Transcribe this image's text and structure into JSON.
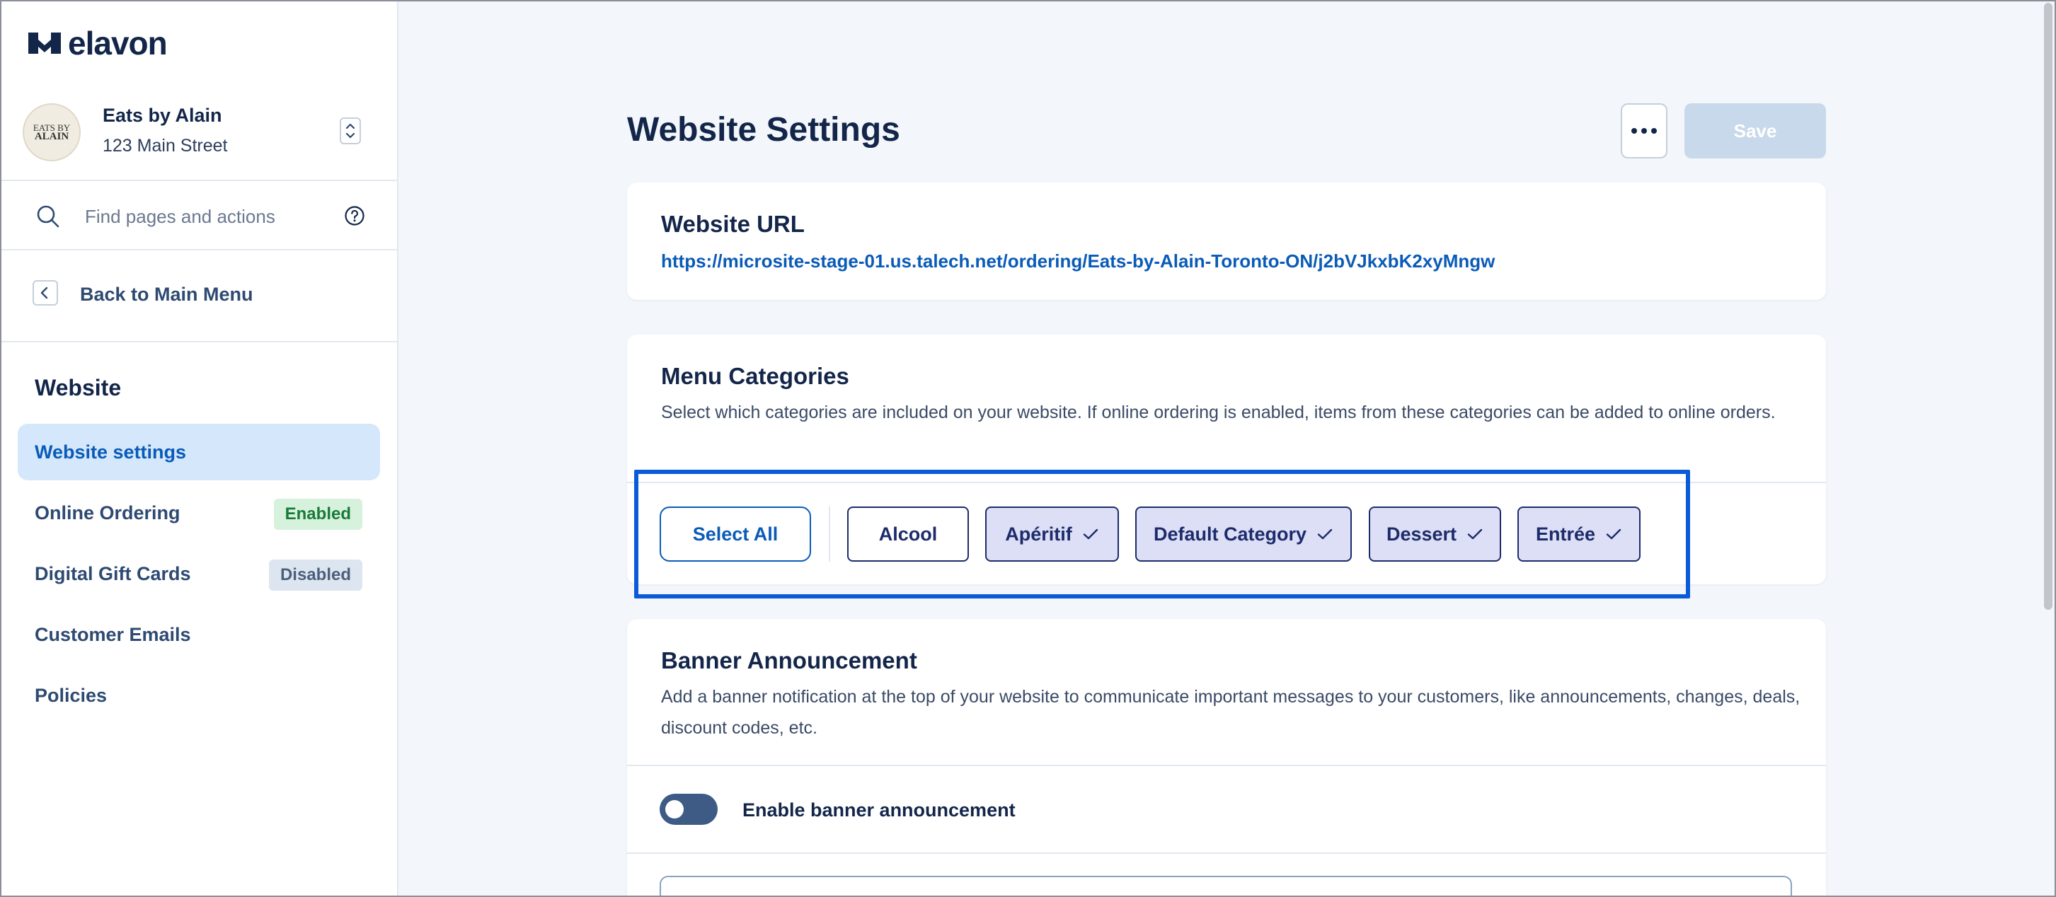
{
  "brand": {
    "name": "elavon"
  },
  "business": {
    "name": "Eats by Alain",
    "address": "123 Main Street",
    "avatar_text": [
      "EATS BY",
      "ALAIN"
    ]
  },
  "search": {
    "placeholder": "Find pages and actions"
  },
  "back": {
    "label": "Back to Main Menu"
  },
  "sidebar": {
    "section_title": "Website",
    "items": [
      {
        "label": "Website settings",
        "active": true
      },
      {
        "label": "Online Ordering",
        "badge": "Enabled"
      },
      {
        "label": "Digital Gift Cards",
        "badge": "Disabled"
      },
      {
        "label": "Customer Emails"
      },
      {
        "label": "Policies"
      }
    ]
  },
  "page": {
    "title": "Website Settings",
    "save_label": "Save"
  },
  "website_url": {
    "title": "Website URL",
    "url": "https://microsite-stage-01.us.talech.net/ordering/Eats-by-Alain-Toronto-ON/j2bVJkxbK2xyMngw"
  },
  "menu_categories": {
    "title": "Menu Categories",
    "description": "Select which categories are included on your website. If online ordering is enabled, items from these categories can be added to online orders.",
    "select_all_label": "Select All",
    "chips": [
      {
        "label": "Alcool",
        "selected": false
      },
      {
        "label": "Apéritif",
        "selected": true
      },
      {
        "label": "Default Category",
        "selected": true
      },
      {
        "label": "Dessert",
        "selected": true
      },
      {
        "label": "Entrée",
        "selected": true
      }
    ]
  },
  "banner": {
    "title": "Banner Announcement",
    "description": "Add a banner notification at the top of your website to communicate important messages to your customers, like announcements, changes, deals, discount codes, etc.",
    "toggle_label": "Enable banner announcement",
    "toggle_on": false
  },
  "colors": {
    "accent": "#0a5bb8",
    "navy": "#13264a",
    "chip_selected_bg": "#dcdff5",
    "highlight": "#0a5bd8"
  }
}
